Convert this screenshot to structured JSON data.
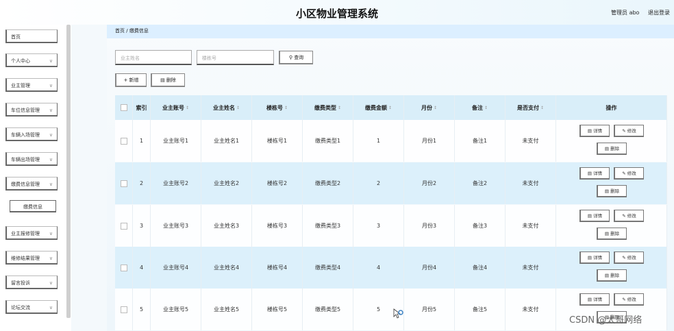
{
  "header": {
    "title": "小区物业管理系统",
    "user_label": "管理员 abo",
    "logout_label": "退出登录"
  },
  "sidebar": {
    "items": [
      {
        "label": "首页",
        "chevron": false
      },
      {
        "label": "个人中心",
        "chevron": true
      },
      {
        "label": "业主管理",
        "chevron": true
      },
      {
        "label": "车位信息管理",
        "chevron": true
      },
      {
        "label": "车辆入场管理",
        "chevron": true
      },
      {
        "label": "车辆出场管理",
        "chevron": true
      },
      {
        "label": "缴费信息管理",
        "chevron": true
      },
      {
        "label": "业主报修管理",
        "chevron": true
      },
      {
        "label": "维修结果管理",
        "chevron": true
      },
      {
        "label": "留言投诉",
        "chevron": true
      },
      {
        "label": "论坛交流",
        "chevron": true
      }
    ],
    "sub_item": "缴费信息"
  },
  "breadcrumb": {
    "home": "首页",
    "sep": "/",
    "current": "缴费信息"
  },
  "search": {
    "owner_name_placeholder": "业主姓名",
    "building_placeholder": "楼栋号",
    "query_label": "查询"
  },
  "toolbar": {
    "add_label": "新增",
    "delete_label": "删除"
  },
  "table": {
    "headers": [
      "索引",
      "业主账号",
      "业主姓名",
      "楼栋号",
      "缴费类型",
      "缴费金额",
      "月份",
      "备注",
      "是否支付",
      "操作"
    ],
    "rows": [
      [
        "1",
        "业主账号1",
        "业主姓名1",
        "楼栋号1",
        "缴费类型1",
        "1",
        "月份1",
        "备注1",
        "未支付"
      ],
      [
        "2",
        "业主账号2",
        "业主姓名2",
        "楼栋号2",
        "缴费类型2",
        "2",
        "月份2",
        "备注2",
        "未支付"
      ],
      [
        "3",
        "业主账号3",
        "业主姓名3",
        "楼栋号3",
        "缴费类型3",
        "3",
        "月份3",
        "备注3",
        "未支付"
      ],
      [
        "4",
        "业主账号4",
        "业主姓名4",
        "楼栋号4",
        "缴费类型4",
        "4",
        "月份4",
        "备注4",
        "未支付"
      ],
      [
        "5",
        "业主账号5",
        "业主姓名5",
        "楼栋号5",
        "缴费类型5",
        "5",
        "月份5",
        "备注5",
        "未支付"
      ]
    ],
    "op_labels": {
      "detail": "详情",
      "edit": "修改",
      "delete": "删除"
    }
  },
  "watermark": "CSDN @太哥网络",
  "colors": {
    "header_row": "#d9eef9",
    "alt_row": "#dcf0fb",
    "bg": "#eef6fb"
  }
}
